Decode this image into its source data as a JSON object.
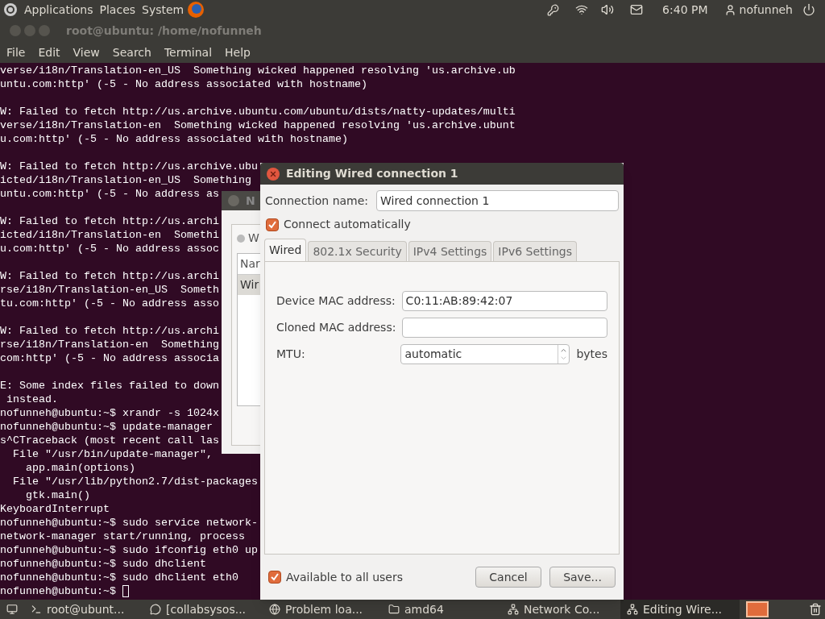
{
  "top_panel": {
    "menus": [
      "Applications",
      "Places",
      "System"
    ],
    "clock": "6:40 PM",
    "user": "nofunneh"
  },
  "terminal": {
    "title": "root@ubuntu: /home/nofunneh",
    "menu": [
      "File",
      "Edit",
      "View",
      "Search",
      "Terminal",
      "Help"
    ],
    "cursor": true,
    "paragraphs": [
      [
        "verse/i18n/Translation-en_US  Something wicked happened resolving 'us.archive.ub",
        "untu.com:http' (-5 - No address associated with hostname)"
      ],
      [
        "W: Failed to fetch http://us.archive.ubuntu.com/ubuntu/dists/natty-updates/multi",
        "verse/i18n/Translation-en  Something wicked happened resolving 'us.archive.ubunt",
        "u.com:http' (-5 - No address associated with hostname)"
      ],
      [
        "W: Failed to fetch http://us.archive.ubu",
        "icted/i18n/Translation-en_US  Something",
        "untu.com:http' (-5 - No address as"
      ],
      [
        "W: Failed to fetch http://us.archi",
        "icted/i18n/Translation-en  Somethi",
        "u.com:http' (-5 - No address assoc"
      ],
      [
        "W: Failed to fetch http://us.archi",
        "rse/i18n/Translation-en_US  Someth",
        "tu.com:http' (-5 - No address asso"
      ],
      [
        "W: Failed to fetch http://us.archi",
        "rse/i18n/Translation-en  Something",
        "com:http' (-5 - No address associa"
      ],
      [
        "E: Some index files failed to down",
        " instead.",
        "nofunneh@ubuntu:~$ xrandr -s 1024x",
        "nofunneh@ubuntu:~$ update-manager",
        "s^CTraceback (most recent call las",
        "  File \"/usr/bin/update-manager\",",
        "    app.main(options)",
        "  File \"/usr/lib/python2.7/dist-packages",
        "    gtk.main()",
        "KeyboardInterrupt",
        "nofunneh@ubuntu:~$ sudo service network-",
        "network-manager start/running, process",
        "nofunneh@ubuntu:~$ sudo ifconfig eth0 up",
        "nofunneh@ubuntu:~$ sudo dhclient",
        "nofunneh@ubuntu:~$ sudo dhclient eth0",
        "nofunneh@ubuntu:~$ "
      ]
    ]
  },
  "back_window": {
    "title": "N",
    "tab": "W",
    "column": "Nar",
    "row": {
      "text": "Wir",
      "selected": true
    }
  },
  "dialog": {
    "title": "Editing Wired connection 1",
    "connection_name_label": "Connection name:",
    "connection_name": "Wired connection 1",
    "connect_automatically": {
      "label": "Connect automatically",
      "checked": true
    },
    "tabs": [
      {
        "label": "Wired",
        "selected": true
      },
      {
        "label": "802.1x Security",
        "selected": false
      },
      {
        "label": "IPv4 Settings",
        "selected": false
      },
      {
        "label": "IPv6 Settings",
        "selected": false
      }
    ],
    "fields": [
      {
        "kind": "text",
        "label": "Device MAC address:",
        "value": "C0:11:AB:89:42:07"
      },
      {
        "kind": "text",
        "label": "Cloned MAC address:"
      },
      {
        "kind": "spin",
        "label": "MTU:",
        "value": "automatic",
        "unit": "bytes"
      }
    ],
    "available_to_all": {
      "label": "Available to all users",
      "checked": true
    },
    "buttons": [
      "Cancel",
      "Save..."
    ]
  },
  "taskbar": [
    {
      "kind": "terminal",
      "label": "root@ubunt...",
      "selected": false
    },
    {
      "kind": "chat",
      "label": "[collabsysos...",
      "selected": false
    },
    {
      "kind": "browser",
      "label": "Problem loa...",
      "selected": false
    },
    {
      "kind": "folder",
      "label": "amd64",
      "selected": false
    },
    {
      "kind": "network",
      "label": "Network Co...",
      "selected": false
    },
    {
      "kind": "network",
      "label": "Editing Wire...",
      "selected": true
    }
  ]
}
